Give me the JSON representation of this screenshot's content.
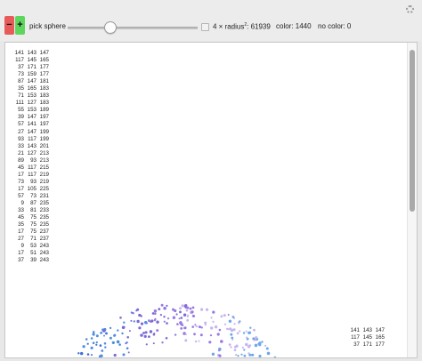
{
  "controls": {
    "minus_label": "−",
    "plus_label": "+",
    "pick_label": "pick sphere",
    "slider_value_fraction": 0.3
  },
  "info": {
    "radius_prefix": "4 × radius",
    "radius_exp": "2",
    "radius_value": ": 61939",
    "color_text": "color: 1440",
    "no_color_text": "no color: 0"
  },
  "triples": [
    [
      "141",
      "143",
      "147"
    ],
    [
      "117",
      "145",
      "165"
    ],
    [
      "37",
      "171",
      "177"
    ],
    [
      "73",
      "159",
      "177"
    ],
    [
      "87",
      "147",
      "181"
    ],
    [
      "35",
      "165",
      "183"
    ],
    [
      "71",
      "153",
      "183"
    ],
    [
      "111",
      "127",
      "183"
    ],
    [
      "55",
      "153",
      "189"
    ],
    [
      "39",
      "147",
      "197"
    ],
    [
      "57",
      "141",
      "197"
    ],
    [
      "27",
      "147",
      "199"
    ],
    [
      "93",
      "117",
      "199"
    ],
    [
      "33",
      "143",
      "201"
    ],
    [
      "21",
      "127",
      "213"
    ],
    [
      "89",
      "93",
      "213"
    ],
    [
      "45",
      "117",
      "215"
    ],
    [
      "17",
      "117",
      "219"
    ],
    [
      "73",
      "93",
      "219"
    ],
    [
      "17",
      "105",
      "225"
    ],
    [
      "57",
      "73",
      "231"
    ],
    [
      "9",
      "87",
      "235"
    ],
    [
      "33",
      "81",
      "233"
    ],
    [
      "45",
      "75",
      "235"
    ],
    [
      "35",
      "75",
      "235"
    ],
    [
      "17",
      "75",
      "237"
    ],
    [
      "27",
      "71",
      "237"
    ],
    [
      "9",
      "53",
      "243"
    ],
    [
      "17",
      "51",
      "243"
    ],
    [
      "37",
      "39",
      "243"
    ]
  ],
  "repeat_triples": [
    [
      "141",
      "143",
      "147"
    ],
    [
      "117",
      "145",
      "165"
    ],
    [
      "37",
      "171",
      "177"
    ]
  ],
  "plot": {
    "type": "3d-point-sphere",
    "colors": [
      "#3a6fd8",
      "#4f8de0",
      "#7a6ad6",
      "#9a7ae0",
      "#c6b6ee",
      "#6fa8e8"
    ]
  }
}
